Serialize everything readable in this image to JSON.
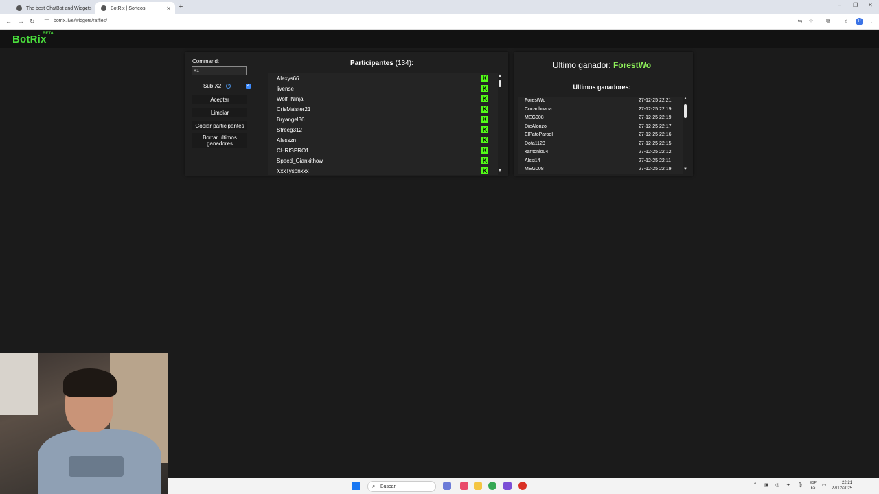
{
  "browser": {
    "tabs": [
      {
        "title": "The best ChatBot and Widgets"
      },
      {
        "title": "BotRix | Sorteos"
      }
    ],
    "new_tab": "+",
    "url": "botrix.live/widgets/raffles/",
    "profile_initial": "P",
    "window_controls": {
      "min": "–",
      "max": "❐",
      "close": "✕"
    }
  },
  "app": {
    "logo": "BotRix",
    "badge": "BETA"
  },
  "raffle": {
    "command_label": "Command:",
    "command_value": "+1",
    "sub_label": "Sub X2",
    "sub_checked": true,
    "buttons": {
      "accept": "Aceptar",
      "clear": "Limpiar",
      "copy": "Copiar participantes",
      "delete_winners": "Borrar ultimos ganadores"
    },
    "participants_title": "Participantes",
    "participants_count": "(134):",
    "participants": [
      "Alexys66",
      "livense",
      "Wolf_Ninja",
      "CrisMaister21",
      "Bryangel36",
      "Streeg312",
      "Alesszn",
      "CHRISPRO1",
      "Speed_Gianxithow",
      "XxxTysonxxx"
    ],
    "platform_icon": "K"
  },
  "winners": {
    "last_label": "Ultimo ganador:",
    "last_name": "ForestWo",
    "list_title": "Ultimos ganadores:",
    "list": [
      {
        "name": "ForestWo",
        "date": "27-12-25 22:21"
      },
      {
        "name": "Cocarihuana",
        "date": "27-12-25 22:19"
      },
      {
        "name": "MEG008",
        "date": "27-12-25 22:19"
      },
      {
        "name": "DieAlonzo",
        "date": "27-12-25 22:17"
      },
      {
        "name": "ElPatoParodI",
        "date": "27-12-25 22:16"
      },
      {
        "name": "Dota1123",
        "date": "27-12-25 22:15"
      },
      {
        "name": "xantonio04",
        "date": "27-12-25 22:12"
      },
      {
        "name": "Alssi14",
        "date": "27-12-25 22:11"
      },
      {
        "name": "MEG008",
        "date": "27-12-25 22:19"
      }
    ]
  },
  "taskbar": {
    "search_placeholder": "Buscar",
    "lang_top": "ESP",
    "lang_bottom": "ES",
    "time": "22:21",
    "date": "27/12/2025"
  },
  "colors": {
    "brand_green": "#4ade3c",
    "kick_green": "#53fc18",
    "winner_green": "#8ef05a"
  }
}
